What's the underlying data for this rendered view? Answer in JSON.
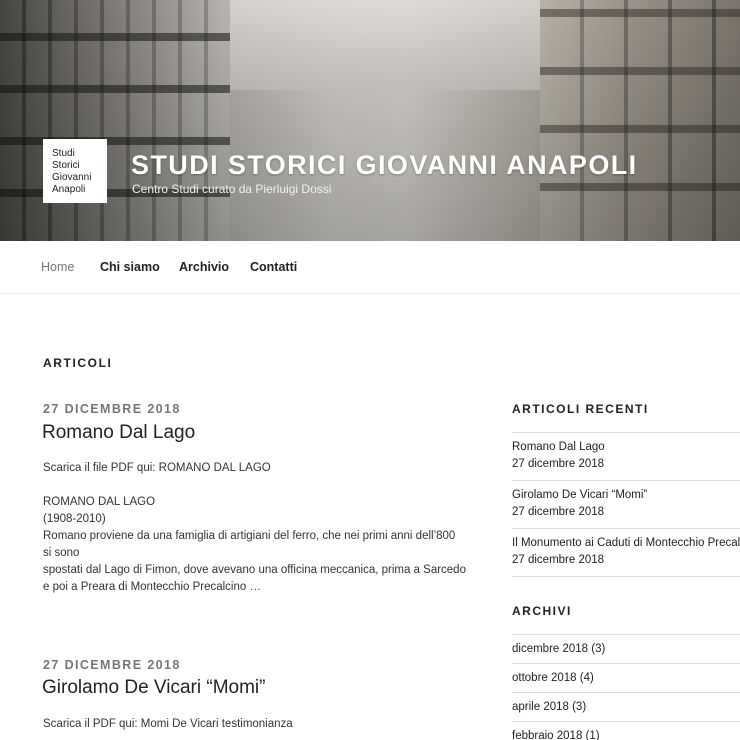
{
  "header": {
    "logo_lines": [
      "Studi",
      "Storici",
      "Giovanni",
      "Anapoli"
    ],
    "site_title": "STUDI STORICI GIOVANNI ANAPOLI",
    "site_description": "Centro Studi curato da Pierluigi Dossi"
  },
  "nav": {
    "items": [
      {
        "label": "Home",
        "current": true
      },
      {
        "label": "Chi siamo",
        "current": false
      },
      {
        "label": "Archivio",
        "current": false
      },
      {
        "label": "Contatti",
        "current": false
      }
    ]
  },
  "main": {
    "section_title": "ARTICOLI",
    "posts": [
      {
        "date": "27 DICEMBRE 2018",
        "title": "Romano Dal Lago",
        "lines": [
          "Scarica il file PDF qui: ROMANO DAL LAGO",
          "",
          "ROMANO DAL LAGO",
          "(1908-2010)",
          "Romano proviene da una famiglia di artigiani del ferro, che nei primi anni dell’800",
          "si sono",
          "spostati dal Lago di Fimon, dove avevano una officina meccanica, prima a Sarcedo",
          "e poi a Preara di Montecchio Precalcino …"
        ]
      },
      {
        "date": "27 DICEMBRE 2018",
        "title": "Girolamo De Vicari “Momi”",
        "lines": [
          "Scarica il PDF qui: Momi De Vicari testimonianza"
        ]
      }
    ]
  },
  "sidebar": {
    "recent_title": "ARTICOLI RECENTI",
    "recent": [
      {
        "title": "Romano Dal Lago",
        "date": "27 dicembre 2018"
      },
      {
        "title": "Girolamo De Vicari “Momi”",
        "date": "27 dicembre 2018"
      },
      {
        "title": "Il Monumento ai Caduti di Montecchio Precalcino",
        "date": "27 dicembre 2018"
      }
    ],
    "archive_title": "ARCHIVI",
    "archives": [
      "dicembre 2018 (3)",
      "ottobre 2018 (4)",
      "aprile 2018 (3)",
      "febbraio 2018 (1)"
    ]
  },
  "colors": {
    "text": "#222222",
    "muted": "#767676",
    "border": "#dddddd"
  }
}
